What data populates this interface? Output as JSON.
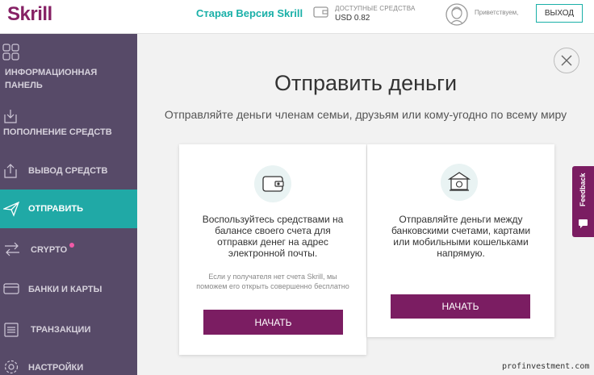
{
  "header": {
    "logo": "Skrill",
    "old_version": "Старая Версия Skrill",
    "balance_label": "ДОСТУПНЫЕ СРЕДСТВА",
    "balance_value": "USD 0.82",
    "greeting": "Приветствуем,",
    "logout": "ВЫХОД"
  },
  "sidebar": {
    "items": [
      {
        "label": "ИНФОРМАЦИОННАЯ ПАНЕЛЬ",
        "icon": "dashboard-grid-icon"
      },
      {
        "label": "ПОПОЛНЕНИЕ СРЕДСТВ",
        "icon": "deposit-icon"
      },
      {
        "label": "ВЫВОД СРЕДСТВ",
        "icon": "withdraw-icon"
      },
      {
        "label": "ОТПРАВИТЬ",
        "icon": "paper-plane-icon"
      },
      {
        "label": "CRYPTO",
        "icon": "swap-arrows-icon"
      },
      {
        "label": "БАНКИ И КАРТЫ",
        "icon": "card-icon"
      },
      {
        "label": "ТРАНЗАКЦИИ",
        "icon": "list-icon"
      },
      {
        "label": "НАСТРОЙКИ",
        "icon": "gear-icon"
      }
    ]
  },
  "main": {
    "title": "Отправить деньги",
    "subtitle": "Отправляйте деньги членам семьи, друзьям или кому-угодно по всему миру",
    "cards": [
      {
        "icon": "wallet-icon",
        "text": "Воспользуйтесь средствами на балансе своего счета для отправки денег на адрес электронной почты.",
        "note": "Если у получателя нет счета Skrill, мы поможем его открыть совершенно бесплатно",
        "button": "НАЧАТЬ"
      },
      {
        "icon": "bank-icon",
        "text": "Отправляйте деньги между банковскими счетами, картами или мобильными кошельками напрямую.",
        "button": "НАЧАТЬ"
      }
    ]
  },
  "feedback": "Feedback",
  "watermark": "profinvestment.com",
  "colors": {
    "brand": "#862165",
    "accent": "#1ab0a8",
    "sidebar_bg": "#574a68",
    "active_item": "#20a9a6",
    "button": "#7b1d62"
  }
}
